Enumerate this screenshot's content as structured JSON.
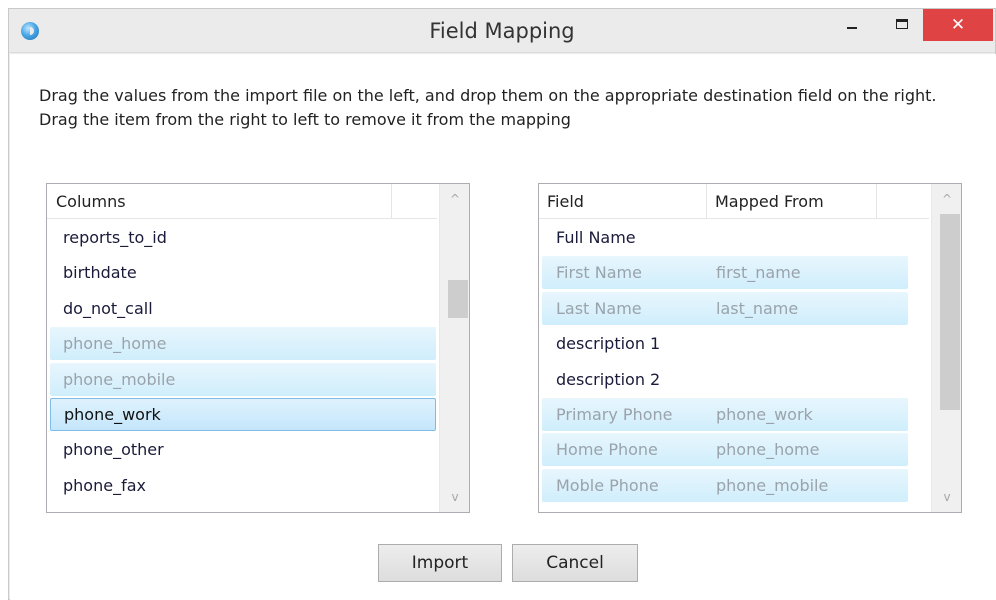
{
  "window": {
    "title": "Field Mapping",
    "close_glyph": "✕"
  },
  "instructions": "Drag the values from the import file on the left, and drop them on the appropriate destination field on the right. Drag the item from the right to left to remove it from the mapping",
  "left_list": {
    "header": "Columns",
    "items": [
      {
        "label": "reports_to_id",
        "state": "normal"
      },
      {
        "label": "birthdate",
        "state": "normal"
      },
      {
        "label": "do_not_call",
        "state": "normal"
      },
      {
        "label": "phone_home",
        "state": "mapped"
      },
      {
        "label": "phone_mobile",
        "state": "mapped"
      },
      {
        "label": "phone_work",
        "state": "selected"
      },
      {
        "label": "phone_other",
        "state": "normal"
      },
      {
        "label": "phone_fax",
        "state": "normal"
      }
    ]
  },
  "right_list": {
    "headers": {
      "field": "Field",
      "mapped_from": "Mapped From"
    },
    "rows": [
      {
        "field": "Full Name",
        "mapped_from": "",
        "state": "normal"
      },
      {
        "field": "First Name",
        "mapped_from": "first_name",
        "state": "mapped"
      },
      {
        "field": "Last Name",
        "mapped_from": "last_name",
        "state": "mapped"
      },
      {
        "field": "description 1",
        "mapped_from": "",
        "state": "normal"
      },
      {
        "field": "description 2",
        "mapped_from": "",
        "state": "normal"
      },
      {
        "field": "Primary Phone",
        "mapped_from": "phone_work",
        "state": "mapped"
      },
      {
        "field": "Home Phone",
        "mapped_from": "phone_home",
        "state": "mapped"
      },
      {
        "field": "Moble Phone",
        "mapped_from": "phone_mobile",
        "state": "mapped"
      }
    ]
  },
  "buttons": {
    "import": "Import",
    "cancel": "Cancel"
  },
  "scroll_glyphs": {
    "up": "^",
    "down": "v"
  },
  "colors": {
    "close_red": "#e04343",
    "selection_blue": "#c4e6fb",
    "mapped_text": "#9aa3ab"
  }
}
